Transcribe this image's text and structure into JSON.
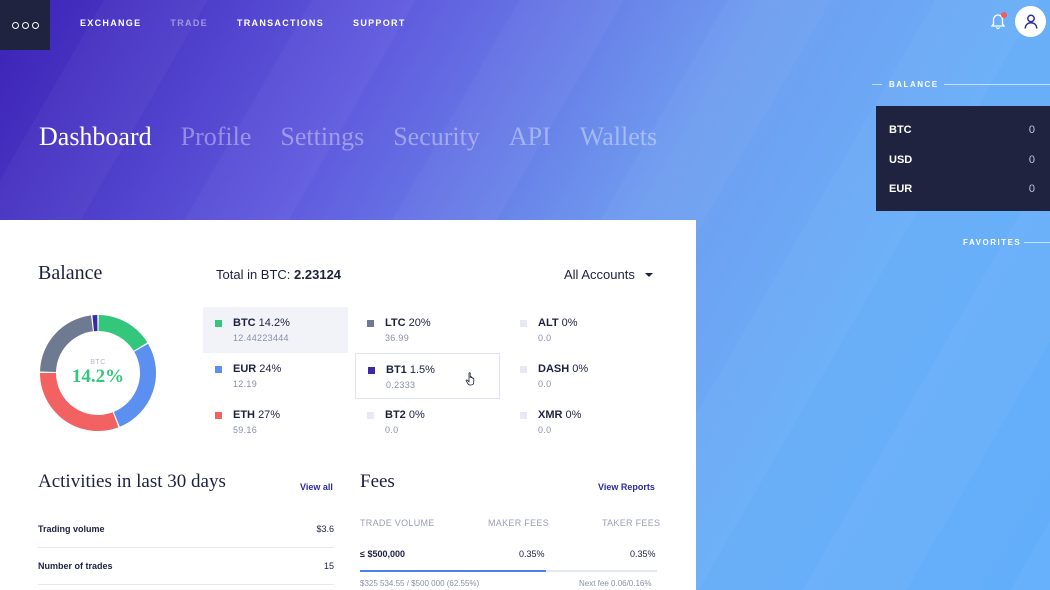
{
  "topbar": {
    "nav": [
      "EXCHANGE",
      "TRADE",
      "TRANSACTIONS",
      "SUPPORT"
    ],
    "active_dim": "TRADE"
  },
  "page_tabs": [
    "Dashboard",
    "Profile",
    "Settings",
    "Security",
    "API",
    "Wallets"
  ],
  "sidebar": {
    "balance_label": "BALANCE",
    "favorites_label": "FAVORITES",
    "balances": [
      {
        "currency": "BTC",
        "value": "0"
      },
      {
        "currency": "USD",
        "value": "0"
      },
      {
        "currency": "EUR",
        "value": "0"
      }
    ]
  },
  "balance": {
    "title": "Balance",
    "total_label": "Total in BTC:",
    "total_value": "2.23124",
    "accounts_label": "All Accounts",
    "donut": {
      "center_label": "BTC",
      "center_value": "14.2%"
    },
    "coins": [
      {
        "symbol": "BTC",
        "pct": "14.2%",
        "amount": "12.44223444",
        "color": "#34c77b"
      },
      {
        "symbol": "EUR",
        "pct": "24%",
        "amount": "12.19",
        "color": "#5b8ff0"
      },
      {
        "symbol": "ETH",
        "pct": "27%",
        "amount": "59.16",
        "color": "#f26262"
      },
      {
        "symbol": "LTC",
        "pct": "20%",
        "amount": "36.99",
        "color": "#6e7a91"
      },
      {
        "symbol": "BT1",
        "pct": "1.5%",
        "amount": "0.2333",
        "color": "#3a2aa8"
      },
      {
        "symbol": "BT2",
        "pct": "0%",
        "amount": "0.0",
        "color": "#e6e9f4"
      },
      {
        "symbol": "ALT",
        "pct": "0%",
        "amount": "0.0",
        "color": "#e6e9f4"
      },
      {
        "symbol": "DASH",
        "pct": "0%",
        "amount": "0.0",
        "color": "#e6e9f4"
      },
      {
        "symbol": "XMR",
        "pct": "0%",
        "amount": "0.0",
        "color": "#e6e9f4"
      }
    ]
  },
  "activities": {
    "title": "Activities in last 30 days",
    "view_all": "View all",
    "rows": [
      {
        "label": "Trading volume",
        "value": "$3.6"
      },
      {
        "label": "Number of trades",
        "value": "15"
      }
    ]
  },
  "fees": {
    "title": "Fees",
    "view_reports": "View Reports",
    "headers": [
      "TRADE VOLUME",
      "MAKER FEES",
      "TAKER FEES"
    ],
    "row": {
      "volume": "≤ $500,000",
      "maker": "0.35%",
      "taker": "0.35%"
    },
    "progress_percent": 62.55,
    "progress_text": "$325 534.55 / $500 000 (62.55%)",
    "next_fee_text": "Next fee 0.06/0.16%"
  }
}
